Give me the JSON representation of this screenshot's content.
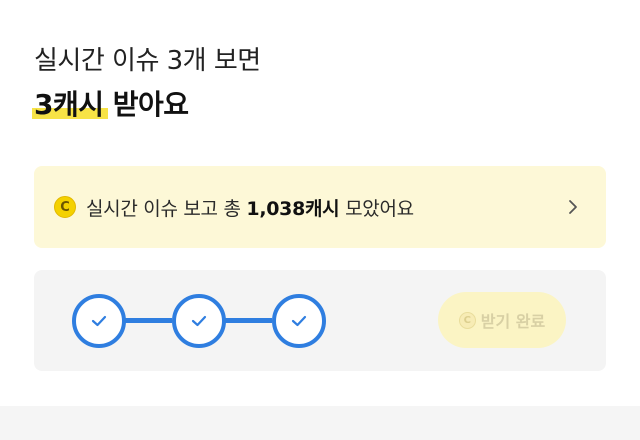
{
  "header": {
    "line1": "실시간 이슈 3개 보면",
    "highlight": "3캐시",
    "line2_rest": " 받아요"
  },
  "info_card": {
    "coin_symbol": "C",
    "text_before": "실시간 이슈 보고 총 ",
    "amount": "1,038캐시",
    "text_after": " 모았어요"
  },
  "progress": {
    "steps_total": 3,
    "steps_completed": 3,
    "claim_coin_symbol": "C",
    "claim_label": "받기 완료",
    "claim_enabled": false
  },
  "colors": {
    "accent_blue": "#2f7ee0",
    "highlight_yellow": "#f7e346",
    "card_yellow": "#fdf8d7"
  }
}
